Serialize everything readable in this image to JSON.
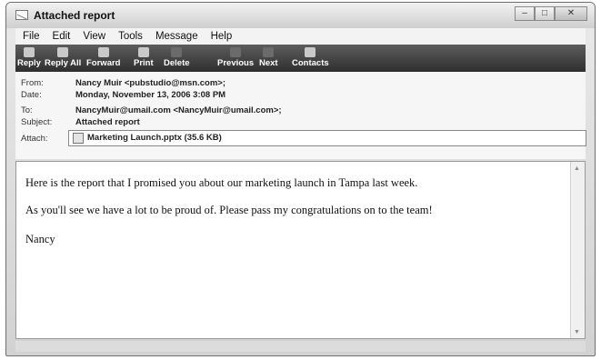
{
  "window": {
    "title": "Attached report"
  },
  "menu": [
    "File",
    "Edit",
    "View",
    "Tools",
    "Message",
    "Help"
  ],
  "toolbar": [
    {
      "label": "Reply",
      "icon": "reply-icon"
    },
    {
      "label": "Reply All",
      "icon": "reply-all-icon"
    },
    {
      "label": "Forward",
      "icon": "forward-icon"
    },
    {
      "label": "Print",
      "icon": "print-icon"
    },
    {
      "label": "Delete",
      "icon": "delete-icon"
    },
    {
      "label": "Previous",
      "icon": "previous-arrow-icon"
    },
    {
      "label": "Next",
      "icon": "next-arrow-icon"
    },
    {
      "label": "Contacts",
      "icon": "contacts-icon"
    }
  ],
  "headers": {
    "from_label": "From:",
    "from": "Nancy Muir <pubstudio@msn.com>;",
    "date_label": "Date:",
    "date": "Monday, November 13, 2006 3:08 PM",
    "to_label": "To:",
    "to": "NancyMuir@umail.com <NancyMuir@umail.com>;",
    "subject_label": "Subject:",
    "subject": "Attached report",
    "attach_label": "Attach:",
    "attachment": "Marketing Launch.pptx (35.6 KB)"
  },
  "message": {
    "p1": "Here is the report that I promised you about our marketing launch in Tampa last week.",
    "p2": "As you'll see we have a lot to be proud of. Please pass my congratulations on to the team!",
    "p3": "Nancy"
  }
}
